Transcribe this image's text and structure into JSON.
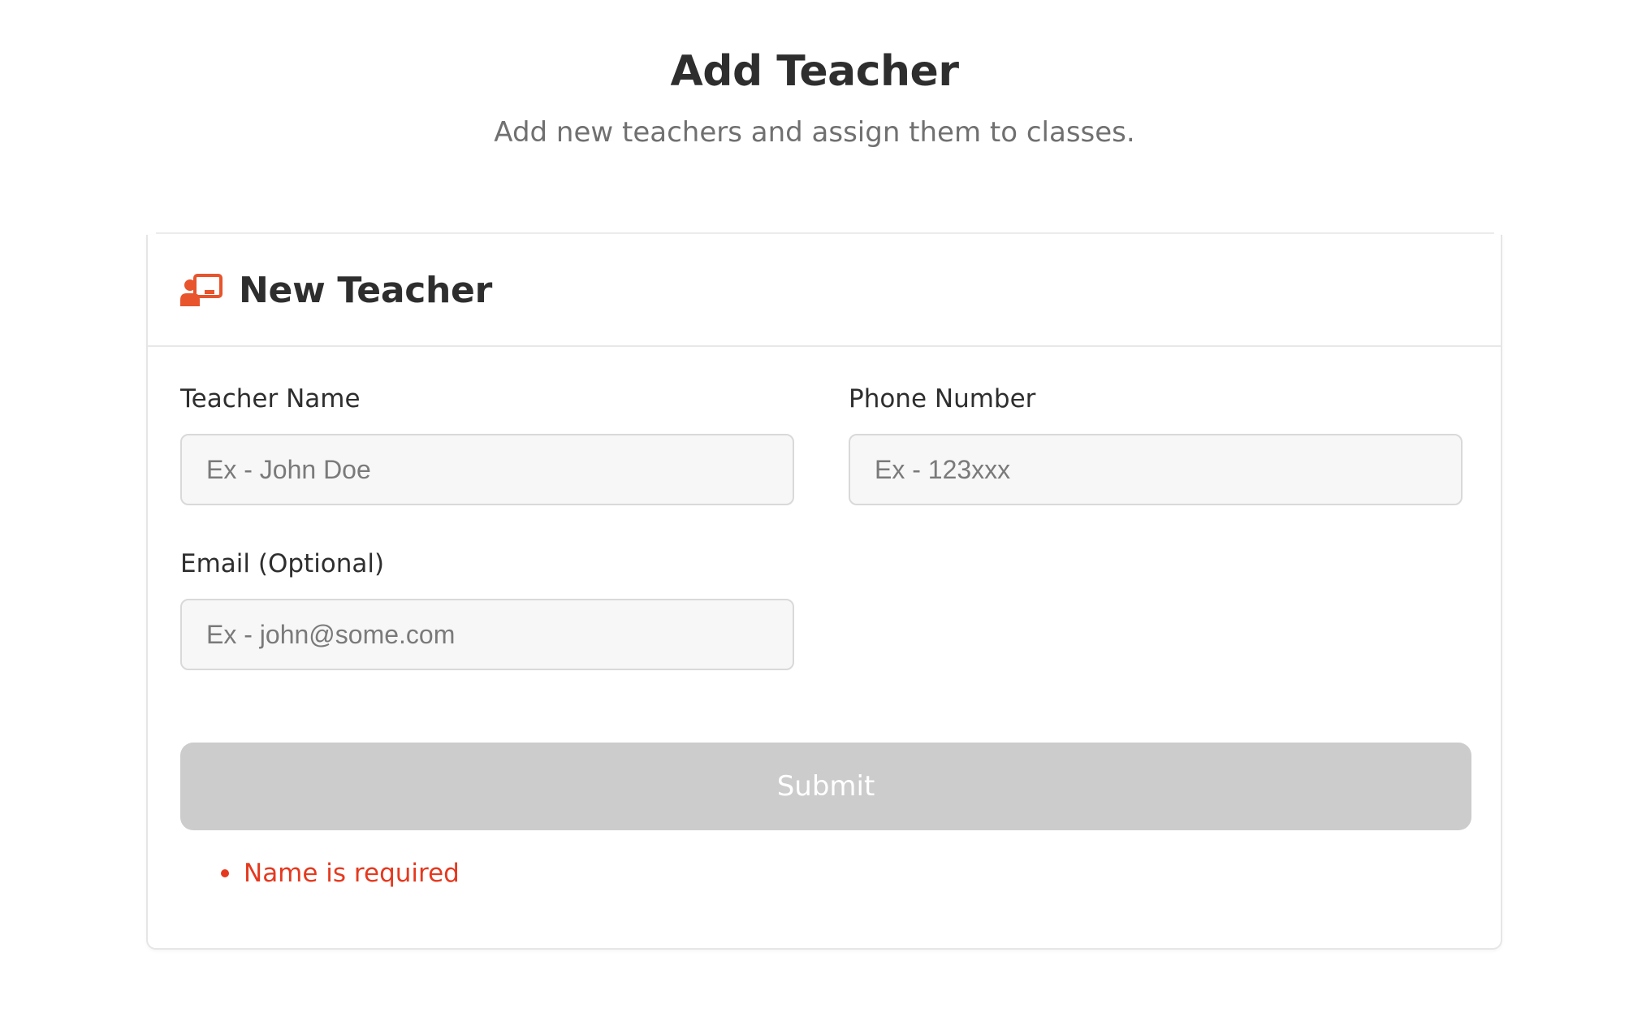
{
  "header": {
    "title": "Add Teacher",
    "subtitle": "Add new teachers and assign them to classes."
  },
  "card": {
    "title": "New Teacher",
    "icon": "teacher-board-icon",
    "accent_color": "#E8542C"
  },
  "form": {
    "teacher_name": {
      "label": "Teacher Name",
      "value": "",
      "placeholder": "Ex - John Doe"
    },
    "phone_number": {
      "label": "Phone Number",
      "value": "",
      "placeholder": "Ex - 123xxx"
    },
    "email": {
      "label": "Email (Optional)",
      "value": "",
      "placeholder": "Ex - john@some.com"
    },
    "submit_label": "Submit",
    "submit_disabled_color": "#CCCCCC"
  },
  "errors": [
    {
      "message": "Name is required",
      "color": "#E5391F"
    }
  ]
}
